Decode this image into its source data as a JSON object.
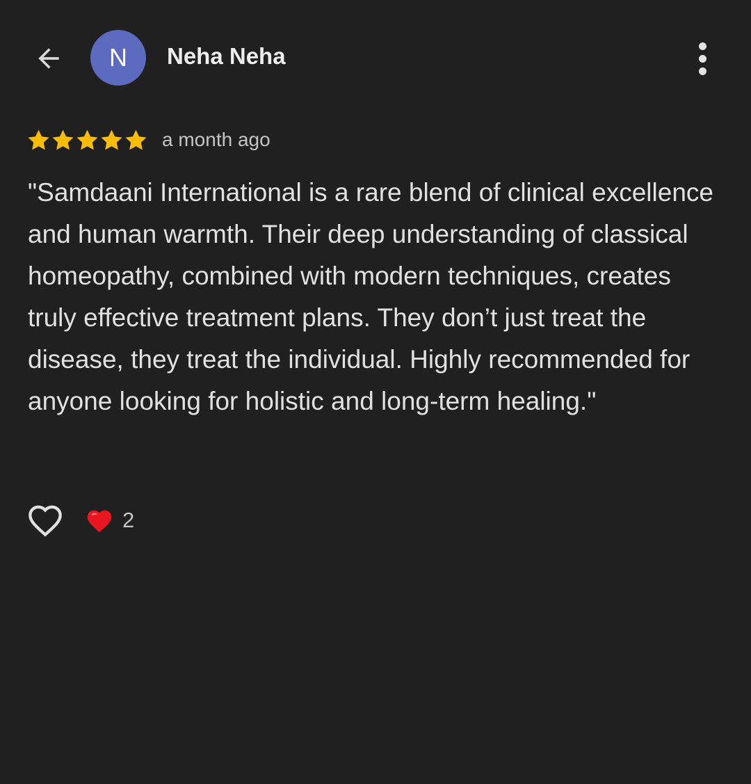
{
  "header": {
    "back_icon": "arrow-back-icon",
    "avatar_letter": "N",
    "avatar_color": "#5c6bc0",
    "author_name": "Neha Neha",
    "more_icon": "more-vertical-icon"
  },
  "review": {
    "rating": 5,
    "rating_max": 5,
    "star_color": "#fbbc04",
    "time_ago": "a month ago",
    "text": "\"Samdaani International is a rare blend of clinical excellence and human warmth. Their deep understanding of classical homeopathy, combined with modern techniques, creates truly effective treatment plans. They don’t just treat the disease, they treat the individual. Highly recommended for anyone looking for holistic and long-term healing.\""
  },
  "reactions": {
    "like_icon": "heart-outline-icon",
    "reaction_icon": "red-heart-icon",
    "count": "2"
  }
}
